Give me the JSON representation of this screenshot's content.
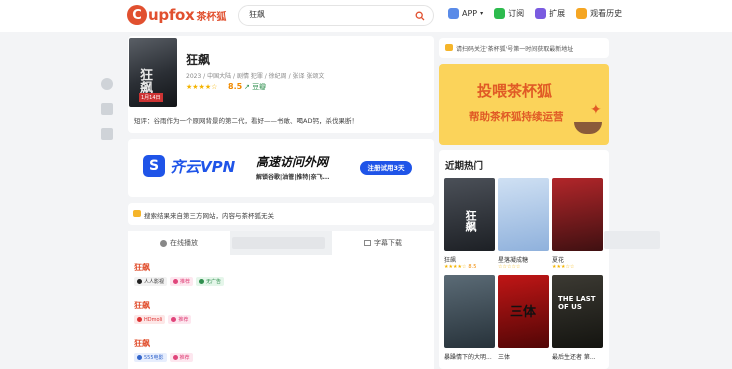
{
  "header": {
    "logo_mark": "C",
    "logo_text": "upfox",
    "logo_sub": "茶杯狐",
    "search_value": "狂飙",
    "nav": [
      {
        "label": "APP",
        "icon": "android-icon",
        "color": "#5a8be8",
        "extra": "▾"
      },
      {
        "label": "订阅",
        "icon": "wechat-icon",
        "color": "#2dbb4e"
      },
      {
        "label": "扩展",
        "icon": "puzzle-icon",
        "color": "#7a5be0"
      },
      {
        "label": "观看历史",
        "icon": "clock-icon",
        "color": "#f5a623"
      }
    ]
  },
  "movie": {
    "title": "狂飙",
    "meta": "2023 / 中国大陆 / 剧情 犯罪 / 徐纪周 / 张译 张颂文",
    "stars": "★★★★☆",
    "score": "8.5",
    "link": "豆瓣",
    "brief": "短评：谷雨作为一个原网背景的第二代，看好——书敢、喝AD钙，杀伐果断！",
    "poster_text": "狂飙",
    "poster_date": "1月14日"
  },
  "vpn": {
    "logo": "S",
    "name": "齐云VPN",
    "slogan": "高速访问外网",
    "sub": "解锁谷歌|油管|推特|奈飞...",
    "btn": "注册试用3天"
  },
  "disclaimer": "搜索结果来自第三方网站，内容与茶杯狐无关",
  "tabs": [
    {
      "label": "在线播放",
      "icon": "play-icon"
    },
    {
      "label": "字幕下载",
      "icon": "download-icon"
    }
  ],
  "results": [
    {
      "title": "狂飙",
      "tags": [
        {
          "label": "人人影视",
          "bg": "#f2f2f2",
          "color": "#333",
          "dot": "#222"
        },
        {
          "label": "推荐",
          "bg": "#fde7ef",
          "color": "#e0457b",
          "dot": "#e0457b"
        },
        {
          "label": "无广告",
          "bg": "#e5f6ea",
          "color": "#2f8f4e",
          "dot": "#2f8f4e"
        }
      ]
    },
    {
      "title": "狂飙",
      "tags": [
        {
          "label": "HDmoli",
          "bg": "#fde7e7",
          "color": "#d33",
          "dot": "#d33"
        },
        {
          "label": "推荐",
          "bg": "#fde7ef",
          "color": "#e0457b",
          "dot": "#e0457b"
        }
      ]
    },
    {
      "title": "狂飙",
      "tags": [
        {
          "label": "555电影",
          "bg": "#e7eefd",
          "color": "#3366cc",
          "dot": "#3366cc"
        },
        {
          "label": "推荐",
          "bg": "#fde7ef",
          "color": "#e0457b",
          "dot": "#e0457b"
        }
      ]
    }
  ],
  "notice": "请扫码关注'茶杯狐'号第一时间获取最新地址",
  "donate": {
    "line1": "投喂茶杯狐",
    "line2": "帮助茶杯狐持续运营"
  },
  "hot": {
    "title": "近期热门",
    "items": [
      {
        "name": "狂飙",
        "stars": "★★★★☆",
        "score": "8.5",
        "colors": [
          "#4b5058",
          "#1d2025"
        ],
        "ptext": "狂飙"
      },
      {
        "name": "星落凝成糖",
        "stars": "☆☆☆☆☆",
        "score": "",
        "colors": [
          "#cfe0f3",
          "#8fb1dc"
        ],
        "ptext": ""
      },
      {
        "name": "夏花",
        "stars": "★★★☆☆",
        "score": "",
        "colors": [
          "#b2262a",
          "#3f1011"
        ],
        "ptext": ""
      },
      {
        "name": "暴躁情下的大明...",
        "stars": "",
        "score": "",
        "colors": [
          "#5b6b76",
          "#27323a"
        ],
        "ptext": ""
      },
      {
        "name": "三体",
        "stars": "",
        "score": "",
        "colors": [
          "#c01616",
          "#520606"
        ],
        "ptext": "三体"
      },
      {
        "name": "最后生还者 第...",
        "stars": "",
        "score": "",
        "colors": [
          "#3c3a33",
          "#141410"
        ],
        "ptext": "THE LAST OF US"
      }
    ]
  }
}
